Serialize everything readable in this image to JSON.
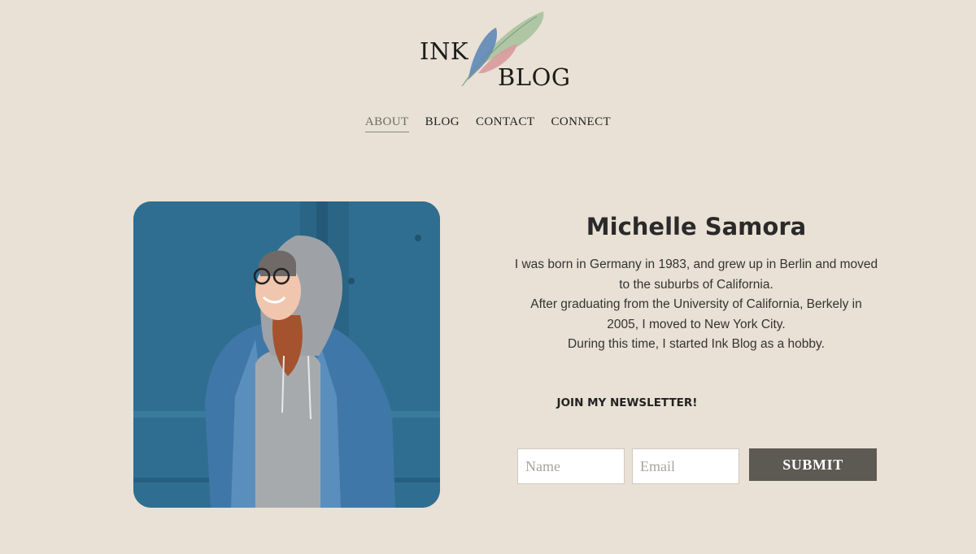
{
  "logo": {
    "line1": "INK",
    "line2": "BLOG",
    "icon": "feather-quills-icon"
  },
  "nav": {
    "items": [
      {
        "label": "ABOUT",
        "active": true
      },
      {
        "label": "BLOG",
        "active": false
      },
      {
        "label": "CONTACT",
        "active": false
      },
      {
        "label": "CONNECT",
        "active": false
      }
    ]
  },
  "profile": {
    "name": "Michelle Samora",
    "bio_lines": [
      "I was born in Germany in 1983, and grew up in Berlin and moved",
      "to the suburbs of California.",
      "After graduating from the University of California, Berkely in",
      "2005, I moved to New York City.",
      "During this time, I started Ink Blog as a hobby."
    ]
  },
  "newsletter": {
    "heading": "JOIN MY NEWSLETTER!",
    "name_placeholder": "Name",
    "email_placeholder": "Email",
    "submit_label": "SUBMIT"
  },
  "colors": {
    "background": "#e9e1d5",
    "submit_button": "#5d5953",
    "photo_wall": "#2f6e90"
  }
}
